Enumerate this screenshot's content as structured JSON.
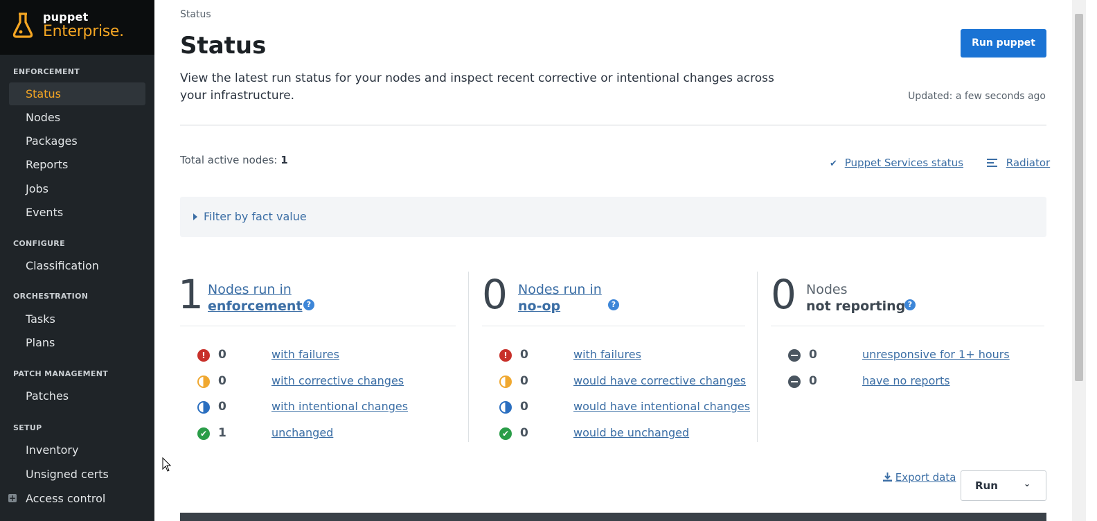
{
  "logo": {
    "small": "puppet",
    "big": "Enterprise",
    "dot": "."
  },
  "sidebar": {
    "sections": [
      {
        "label": "ENFORCEMENT"
      },
      {
        "label": "CONFIGURE"
      },
      {
        "label": "ORCHESTRATION"
      },
      {
        "label": "PATCH MANAGEMENT"
      },
      {
        "label": "SETUP"
      }
    ],
    "items": [
      {
        "label": "Status"
      },
      {
        "label": "Nodes"
      },
      {
        "label": "Packages"
      },
      {
        "label": "Reports"
      },
      {
        "label": "Jobs"
      },
      {
        "label": "Events"
      },
      {
        "label": "Classification"
      },
      {
        "label": "Tasks"
      },
      {
        "label": "Plans"
      },
      {
        "label": "Patches"
      },
      {
        "label": "Inventory"
      },
      {
        "label": "Unsigned certs"
      },
      {
        "label": "Access control"
      }
    ],
    "active_item": "Status"
  },
  "header": {
    "breadcrumb": "Status",
    "title": "Status",
    "description": "View the latest run status for your nodes and inspect recent corrective or intentional changes across your infrastructure.",
    "run_button": "Run puppet",
    "updated": "Updated: a few seconds ago"
  },
  "summary": {
    "total_label": "Total active nodes:",
    "total_value": "1",
    "services_link": "Puppet Services status",
    "radiator_link": "Radiator"
  },
  "filter": {
    "label": "Filter by fact value"
  },
  "columns": [
    {
      "count": "1",
      "head_line1": "Nodes run in",
      "head_line2": "enforcement",
      "rows": [
        {
          "count": "0",
          "label": "with failures"
        },
        {
          "count": "0",
          "label": "with corrective changes"
        },
        {
          "count": "0",
          "label": "with intentional changes"
        },
        {
          "count": "1",
          "label": "unchanged"
        }
      ]
    },
    {
      "count": "0",
      "head_line1": "Nodes run in",
      "head_line2": "no-op",
      "rows": [
        {
          "count": "0",
          "label": "with failures"
        },
        {
          "count": "0",
          "label": "would have corrective changes"
        },
        {
          "count": "0",
          "label": "would have intentional changes"
        },
        {
          "count": "0",
          "label": "would be unchanged"
        }
      ]
    },
    {
      "count": "0",
      "head_line1": "Nodes",
      "head_line2": "not reporting",
      "rows": [
        {
          "count": "0",
          "label": "unresponsive for 1+ hours"
        },
        {
          "count": "0",
          "label": "have no reports"
        }
      ]
    }
  ],
  "help_glyph": "?",
  "icons": {
    "fail_glyph": "!",
    "ok_glyph": "✔",
    "check_glyph": "✔",
    "chevron_glyph": "⌄"
  },
  "bottom": {
    "export_label": "Export data",
    "run_label": "Run"
  },
  "colors": {
    "accent_orange": "#f5a623",
    "primary_blue": "#1a73d4",
    "link_blue": "#3b6ea5",
    "failure_red": "#c8302a",
    "corrective_orange": "#f0a830",
    "intentional_blue": "#2b6fc0",
    "success_green": "#2a9d48"
  }
}
